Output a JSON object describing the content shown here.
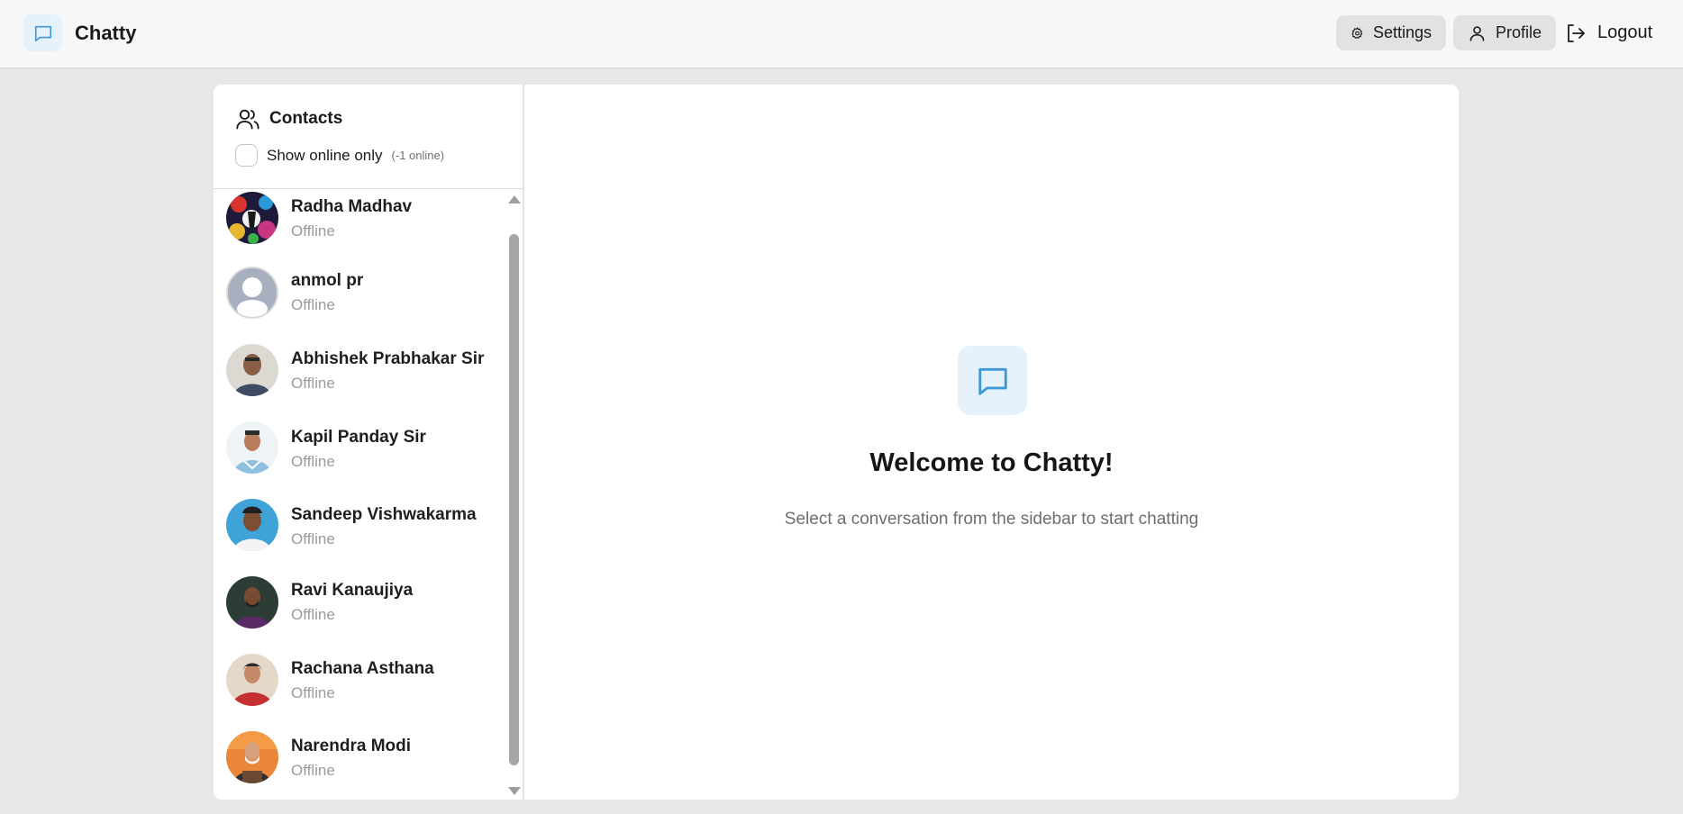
{
  "app": {
    "name": "Chatty"
  },
  "navbar": {
    "settings_label": "Settings",
    "profile_label": "Profile",
    "logout_label": "Logout"
  },
  "sidebar": {
    "title": "Contacts",
    "online_filter_label": "Show online only",
    "online_count": "(-1 online)",
    "contacts": [
      {
        "name": "Radha Madhav",
        "status": "Offline"
      },
      {
        "name": "anmol pr",
        "status": "Offline"
      },
      {
        "name": "Abhishek Prabhakar Sir",
        "status": "Offline"
      },
      {
        "name": "Kapil Panday Sir",
        "status": "Offline"
      },
      {
        "name": "Sandeep Vishwakarma",
        "status": "Offline"
      },
      {
        "name": "Ravi Kanaujiya",
        "status": "Offline"
      },
      {
        "name": "Rachana Asthana",
        "status": "Offline"
      },
      {
        "name": "Narendra Modi",
        "status": "Offline"
      }
    ]
  },
  "welcome": {
    "title": "Welcome to Chatty!",
    "subtitle": "Select a conversation from the sidebar to start chatting"
  },
  "colors": {
    "accent": "#3e98d8",
    "accent_bg": "#e5f1fb",
    "page_bg": "#e7e7e7",
    "status_offline": "#9b9b9b"
  }
}
